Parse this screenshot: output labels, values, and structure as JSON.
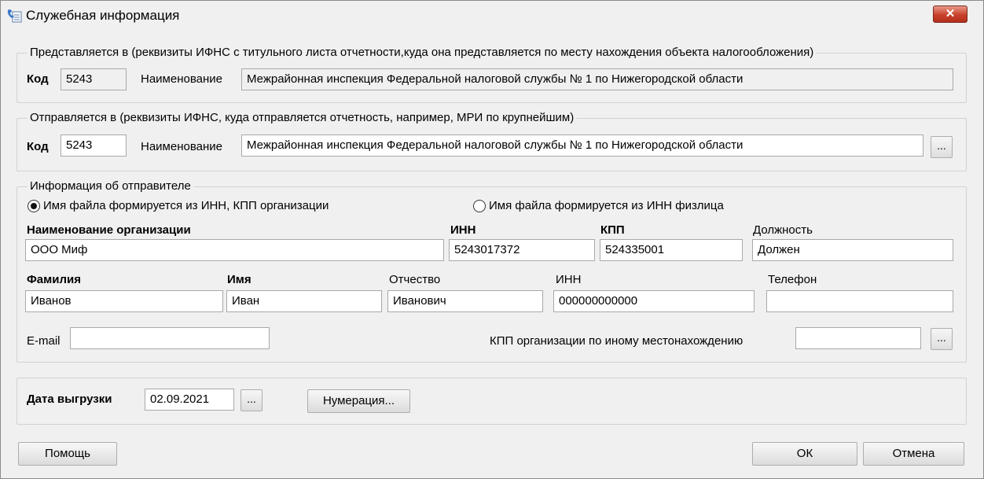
{
  "window": {
    "title": "Служебная информация",
    "close_label": "✕"
  },
  "presented_to": {
    "legend": "Представляется в (реквизиты ИФНС с титульного листа отчетности,куда она представляется по месту нахождения объекта налогообложения)",
    "code_label": "Код",
    "code_value": "5243",
    "name_label": "Наименование",
    "name_value": "Межрайонная инспекция Федеральной налоговой службы № 1 по Нижегородской области"
  },
  "sent_to": {
    "legend": "Отправляется в (реквизиты ИФНС, куда отправляется отчетность, например, МРИ по крупнейшим)",
    "code_label": "Код",
    "code_value": "5243",
    "name_label": "Наименование",
    "name_value": "Межрайонная инспекция Федеральной налоговой службы № 1 по Нижегородской области",
    "browse_label": "..."
  },
  "sender": {
    "legend": "Информация об отправителе",
    "radio_org": "Имя файла формируется из ИНН, КПП организации",
    "radio_person": "Имя файла формируется из ИНН физлица",
    "org_name_label": "Наименование организации",
    "org_name_value": "ООО Миф",
    "inn_label": "ИНН",
    "inn_value": "5243017372",
    "kpp_label": "КПП",
    "kpp_value": "524335001",
    "position_label": "Должность",
    "position_value": "Должен",
    "surname_label": "Фамилия",
    "surname_value": "Иванов",
    "firstname_label": "Имя",
    "firstname_value": "Иван",
    "patronymic_label": "Отчество",
    "patronymic_value": "Иванович",
    "person_inn_label": "ИНН",
    "person_inn_value": "000000000000",
    "phone_label": "Телефон",
    "phone_value": "",
    "email_label": "E-mail",
    "email_value": "",
    "kpp_other_label": "КПП организации по иному местонахождению",
    "kpp_other_value": "",
    "kpp_other_browse": "..."
  },
  "export": {
    "date_label": "Дата выгрузки",
    "date_value": "02.09.2021",
    "date_browse": "...",
    "numbering_label": "Нумерация..."
  },
  "footer": {
    "help_label": "Помощь",
    "ok_label": "ОК",
    "cancel_label": "Отмена"
  }
}
